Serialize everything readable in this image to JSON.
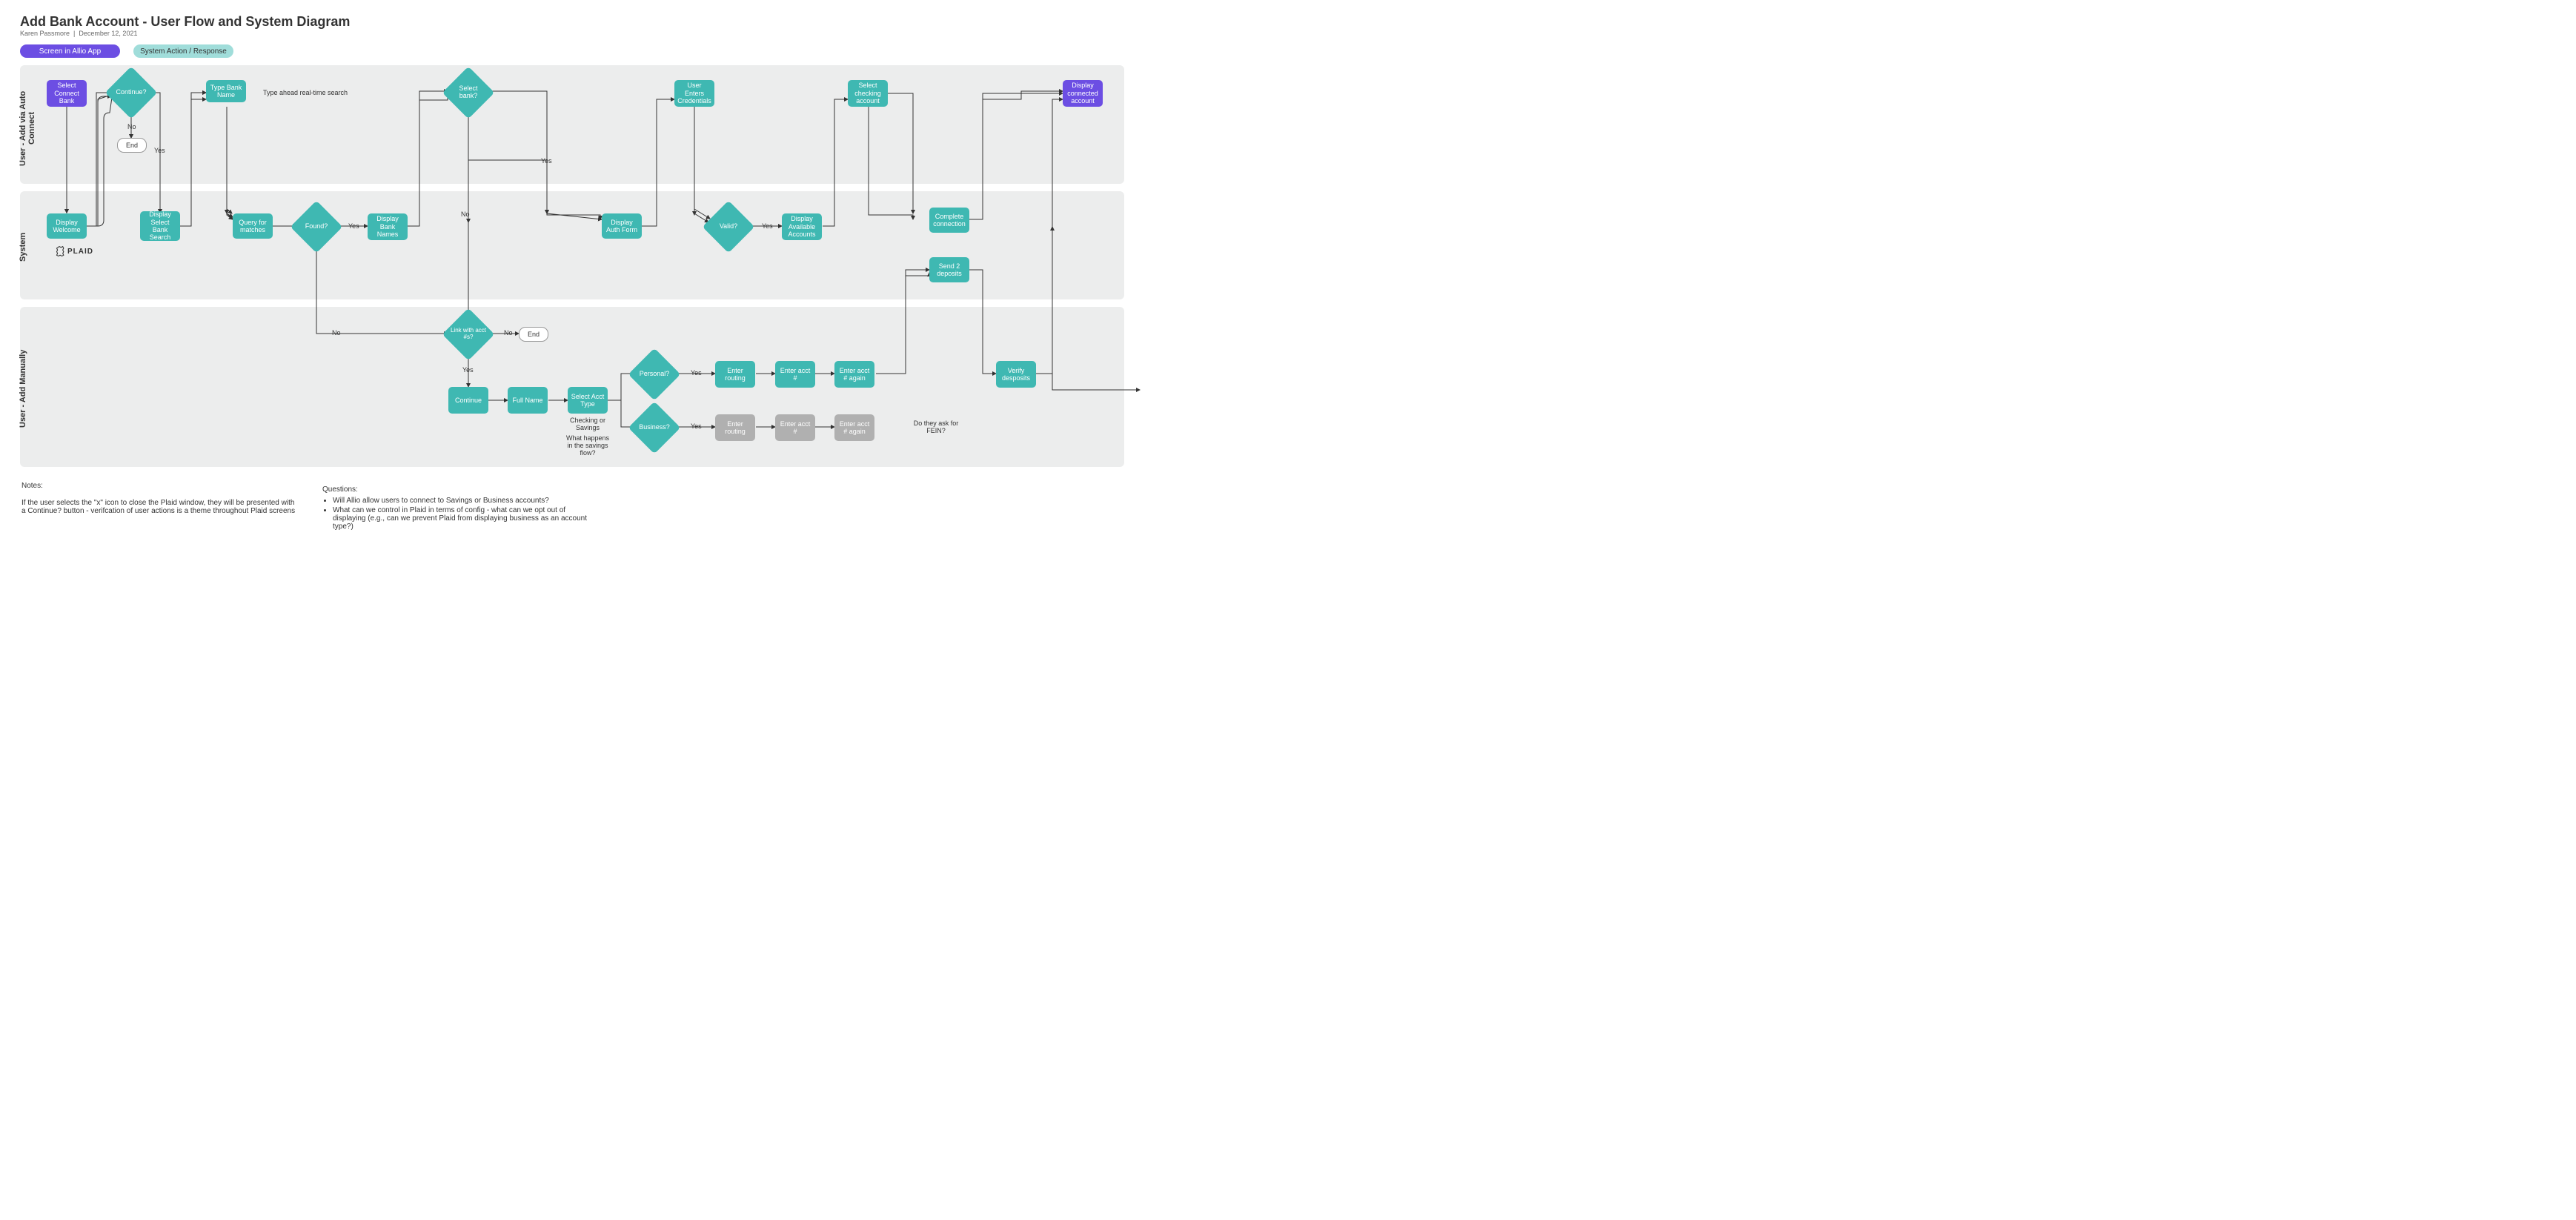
{
  "header": {
    "title": "Add Bank Account - User Flow and System Diagram",
    "author": "Karen Passmore",
    "date": "December 12, 2021",
    "separator": "|"
  },
  "legend": {
    "screen": "Screen in Allio App",
    "system": "System Action / Response"
  },
  "lanes": {
    "lane1": "User - Add via Auto Connect",
    "lane2": "System",
    "lane3": "User - Add Manually",
    "plaid": "PLAID"
  },
  "nodes": {
    "select_connect_bank": "Select Connect Bank",
    "continue_q": "Continue?",
    "end1": "End",
    "type_bank_name": "Type Bank\nName",
    "type_ahead": "Type ahead real-time search",
    "select_bank_q": "Select bank?",
    "user_enters_credentials": "User Enters Credentials",
    "select_checking_account": "Select checking account",
    "display_connected_account": "Display connected account",
    "display_welcome": "Display Welcome",
    "display_select_bank_search": "Display Select Bank Search",
    "query_for_matches": "Query for matches",
    "found_q": "Found?",
    "display_bank_names": "Display Bank Names",
    "display_auth_form": "Display Auth Form",
    "valid_q": "Valid?",
    "display_available_accounts": "Display Available Accounts",
    "complete_connection": "Complete connection",
    "send_2_deposits": "Send 2 deposits",
    "link_with_acct_q": "Link with acct #s?",
    "end2": "End",
    "continue_btn": "Continue",
    "full_name": "Full Name",
    "select_acct_type": "Select Acct Type",
    "personal_q": "Personal?",
    "business_q": "Business?",
    "enter_routing": "Enter routing",
    "enter_acct_num": "Enter acct #",
    "enter_acct_num_again": "Enter acct # again",
    "verify_deposits": "Verify desposits",
    "checking_or_savings": "Checking or Savings",
    "what_happens_savings": "What happens in the savings flow?",
    "do_they_ask_fein": "Do they ask for FEIN?"
  },
  "edges": {
    "yes": "Yes",
    "no": "No"
  },
  "notes": {
    "heading": "Notes:",
    "body": "If the user selects the \"x\" icon to close the Plaid window, they will be presented with a Continue? button - verifcation of user actions is a theme throughout Plaid screens"
  },
  "questions": {
    "heading": "Questions:",
    "q1": "Will Allio allow users to connect to Savings or Business accounts?",
    "q2": "What can we control in Plaid in terms of config - what can we opt out of displaying (e.g., can we prevent Plaid from displaying business as an account type?)"
  }
}
